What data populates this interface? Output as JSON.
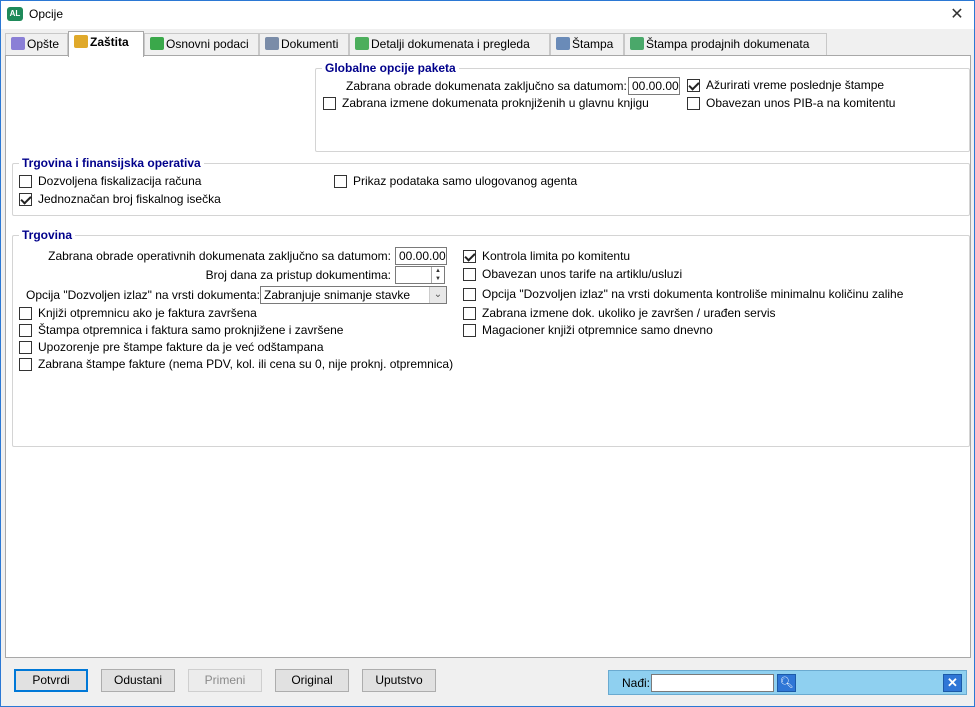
{
  "window": {
    "title": "Opcije",
    "app_icon": "app-logo-icon",
    "close": "✕"
  },
  "tabs": [
    {
      "label": "Opšte",
      "icon": "gear-icon"
    },
    {
      "label": "Zaštita",
      "icon": "lock-icon"
    },
    {
      "label": "Osnovni podaci",
      "icon": "folders-icon"
    },
    {
      "label": "Dokumenti",
      "icon": "document-icon"
    },
    {
      "label": "Detalji dokumenata i pregleda",
      "icon": "document-list-icon"
    },
    {
      "label": "Štampa",
      "icon": "printer-icon"
    },
    {
      "label": "Štampa prodajnih dokumenata",
      "icon": "printer-green-icon"
    }
  ],
  "active_tab": "Zaštita",
  "global": {
    "title": "Globalne opcije paketa",
    "lock_date_label": "Zabrana obrade dokumenata zaključno sa datumom:",
    "lock_date_value": "00.00.00",
    "update_print_time": {
      "label": "Ažurirati vreme poslednje štampe",
      "checked": true
    },
    "forbid_posted_edit": {
      "label": "Zabrana izmene dokumenata proknjiženih u glavnu knjigu",
      "checked": false
    },
    "require_pib": {
      "label": "Obavezan unos PIB-a na komitentu",
      "checked": false
    }
  },
  "finance": {
    "title": "Trgovina i finansijska operativa",
    "fiscalization": {
      "label": "Dozvoljena fiskalizacija računa",
      "checked": false
    },
    "unique_fiscal": {
      "label": "Jednoznačan broj fiskalnog isečka",
      "checked": true
    },
    "agent_only": {
      "label": "Prikaz podataka samo ulogovanog agenta",
      "checked": false
    }
  },
  "trade": {
    "title": "Trgovina",
    "op_lock_label": "Zabrana obrade operativnih dokumenata zaključno sa datumom:",
    "op_lock_value": "00.00.00",
    "days_label": "Broj dana za pristup dokumentima:",
    "days_value": "",
    "exit_label": "Opcija \"Dozvoljen izlaz\" na vrsti dokumenta:",
    "exit_value": "Zabranjuje snimanje stavke",
    "left_checks": [
      {
        "label": "Knjiži otpremnicu ako je faktura završena",
        "checked": false
      },
      {
        "label": "Štampa otpremnica i faktura samo proknjižene i završene",
        "checked": false
      },
      {
        "label": "Upozorenje pre štampe fakture da je već odštampana",
        "checked": false
      },
      {
        "label": "Zabrana štampe fakture (nema PDV, kol. ili cena su 0, nije proknj. otpremnica)",
        "checked": false
      }
    ],
    "right_checks": [
      {
        "label": "Kontrola limita po komitentu",
        "checked": true
      },
      {
        "label": "Obavezan unos tarife na artiklu/usluzi",
        "checked": false
      },
      {
        "label": "Opcija \"Dozvoljen izlaz\" na vrsti dokumenta kontroliše minimalnu količinu zalihe",
        "checked": false
      },
      {
        "label": "Zabrana izmene dok. ukoliko je završen / urađen servis",
        "checked": false
      },
      {
        "label": "Magacioner knjiži otpremnice samo dnevno",
        "checked": false
      }
    ]
  },
  "buttons": {
    "confirm": "Potvrdi",
    "cancel": "Odustani",
    "apply": "Primeni",
    "original": "Original",
    "help": "Uputstvo"
  },
  "find": {
    "label": "Nađi:",
    "value": "",
    "search_icon": "search-icon",
    "close_icon": "close-icon"
  }
}
